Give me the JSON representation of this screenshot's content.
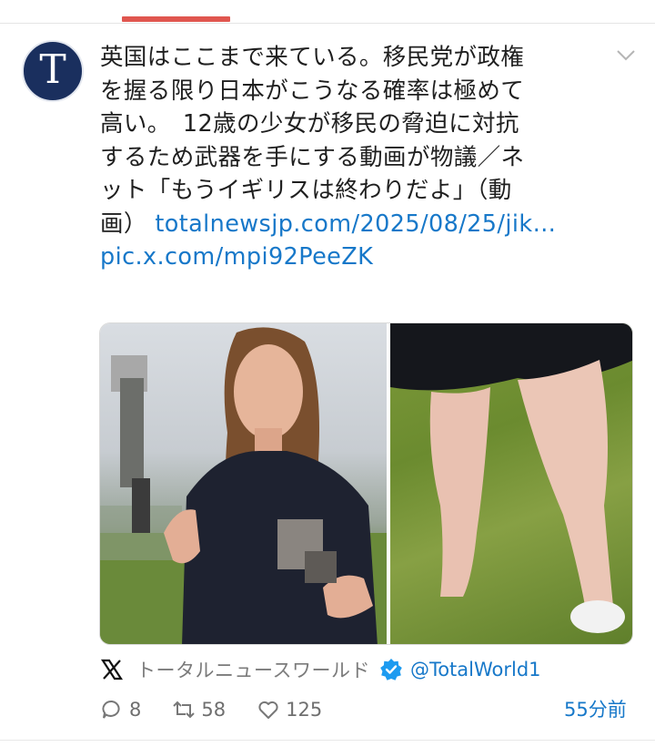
{
  "account": {
    "avatar_letter": "T",
    "display_name": "トータルニュースワールド",
    "handle": "@TotalWorld1",
    "avatar_color": "#1a2f5e",
    "verified_color": "#1d9bf0"
  },
  "tweet": {
    "lines": [
      "英国はここまで来ている。移民党が政権",
      "を握る限り日本がこうなる確率は極めて",
      "高い。　12歳の少女が移民の脅迫に対抗",
      "するため武器を手にする動画が物議／ネ",
      "ット「もうイギリスは終わりだよ」（動"
    ],
    "line6_text": "画）",
    "link_url": "totalnewsjp.com/2025/08/25/jik…",
    "pic_link": "pic.x.com/mpi92PeeZK",
    "link_color": "#1778c9"
  },
  "media": {
    "left_image": "girl-holding-blurred-object-photo",
    "right_image": "legs-on-grass-photo"
  },
  "stats": {
    "replies": "8",
    "retweets": "58",
    "likes": "125",
    "time": "55分前"
  },
  "icons": {
    "more": "chevron-down-icon",
    "x_logo": "x-logo-icon",
    "verified": "verified-badge-icon",
    "reply": "reply-icon",
    "retweet": "retweet-icon",
    "like": "heart-icon"
  },
  "accent": "#e0564f"
}
